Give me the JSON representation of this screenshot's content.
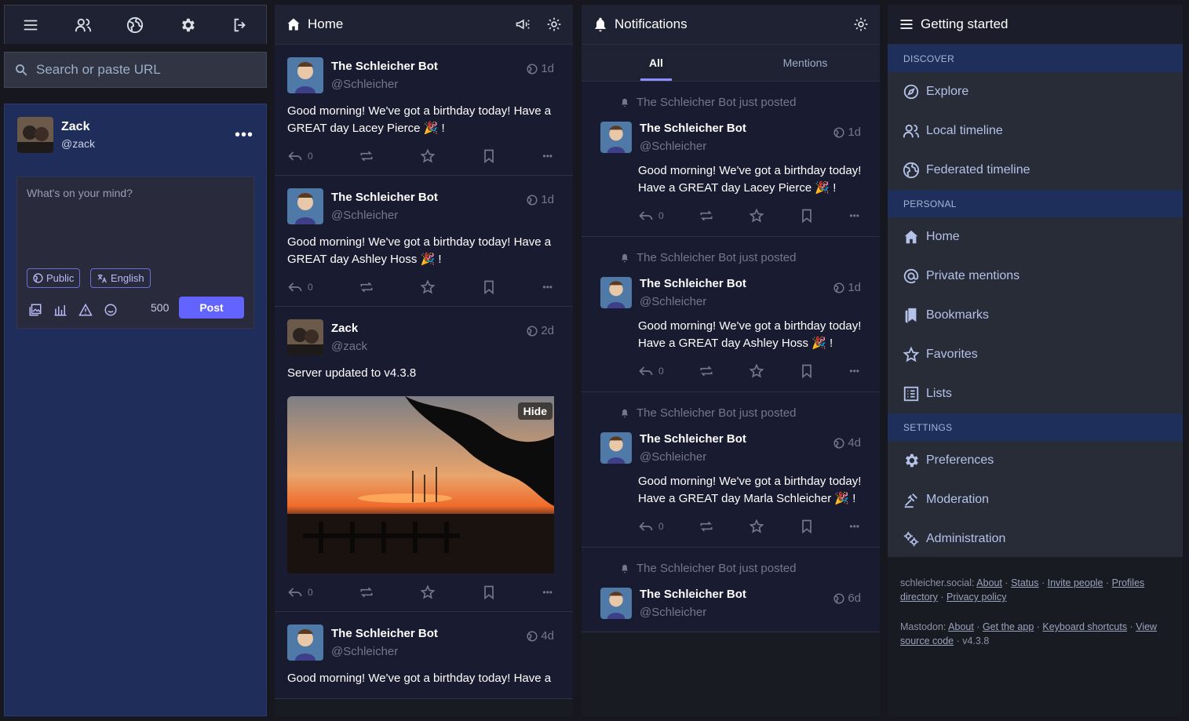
{
  "nav": {
    "icons": [
      "menu-icon",
      "people-icon",
      "globe-icon",
      "gear-icon",
      "logout-icon"
    ]
  },
  "search": {
    "placeholder": "Search or paste URL"
  },
  "compose": {
    "name": "Zack",
    "handle": "@zack",
    "placeholder": "What's on your mind?",
    "visibility": "Public",
    "language": "English",
    "counter": "500",
    "post_label": "Post"
  },
  "home": {
    "title": "Home",
    "statuses": [
      {
        "name": "The Schleicher Bot",
        "handle": "@Schleicher",
        "time": "1d",
        "text": "Good morning!  We've got a birthday today! Have a GREAT day Lacey Pierce 🎉 !",
        "replies": "0"
      },
      {
        "name": "The Schleicher Bot",
        "handle": "@Schleicher",
        "time": "1d",
        "text": "Good morning!  We've got a birthday today! Have a GREAT day Ashley Hoss 🎉 !",
        "replies": "0"
      },
      {
        "name": "Zack",
        "handle": "@zack",
        "time": "2d",
        "text": "Server updated to v4.3.8",
        "replies": "0",
        "hide_label": "Hide"
      },
      {
        "name": "The Schleicher Bot",
        "handle": "@Schleicher",
        "time": "4d",
        "text": "Good morning!  We've got a birthday today! Have a"
      }
    ]
  },
  "notifications": {
    "title": "Notifications",
    "tabs": [
      "All",
      "Mentions"
    ],
    "items": [
      {
        "line": "The Schleicher Bot just posted",
        "name": "The Schleicher Bot",
        "handle": "@Schleicher",
        "time": "1d",
        "text": "Good morning!  We've got a birthday today! Have a GREAT day Lacey Pierce 🎉 !",
        "replies": "0"
      },
      {
        "line": "The Schleicher Bot just posted",
        "name": "The Schleicher Bot",
        "handle": "@Schleicher",
        "time": "1d",
        "text": "Good morning!  We've got a birthday today! Have a GREAT day Ashley Hoss 🎉 !",
        "replies": "0"
      },
      {
        "line": "The Schleicher Bot just posted",
        "name": "The Schleicher Bot",
        "handle": "@Schleicher",
        "time": "4d",
        "text": "Good morning!  We've got a birthday today! Have a GREAT day Marla Schleicher 🎉 !",
        "replies": "0"
      },
      {
        "line": "The Schleicher Bot just posted",
        "name": "The Schleicher Bot",
        "handle": "@Schleicher",
        "time": "6d"
      }
    ]
  },
  "getting_started": {
    "title": "Getting started",
    "sections": [
      {
        "label": "DISCOVER",
        "items": [
          "Explore",
          "Local timeline",
          "Federated timeline"
        ]
      },
      {
        "label": "PERSONAL",
        "items": [
          "Home",
          "Private mentions",
          "Bookmarks",
          "Favorites",
          "Lists"
        ]
      },
      {
        "label": "SETTINGS",
        "items": [
          "Preferences",
          "Moderation",
          "Administration"
        ]
      }
    ],
    "footer": {
      "server": "schleicher.social",
      "server_links": [
        "About",
        "Status",
        "Invite people",
        "Profiles directory",
        "Privacy policy"
      ],
      "mastodon": "Mastodon",
      "mastodon_links": [
        "About",
        "Get the app",
        "Keyboard shortcuts",
        "View source code"
      ],
      "version": "v4.3.8"
    }
  }
}
